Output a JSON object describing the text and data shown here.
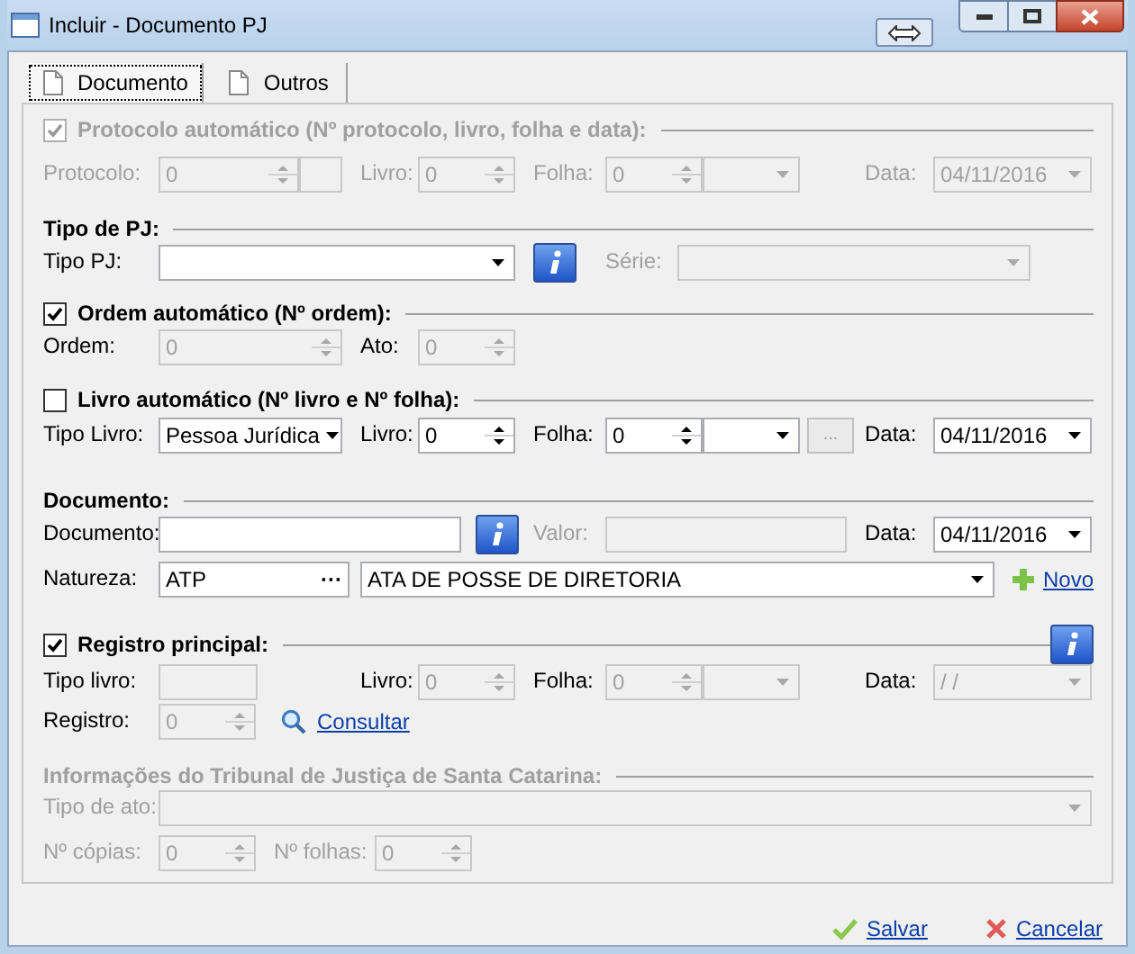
{
  "window": {
    "title": "Incluir - Documento PJ"
  },
  "tabs": [
    {
      "label": "Documento",
      "selected": true
    },
    {
      "label": "Outros",
      "selected": false
    }
  ],
  "protocolo": {
    "title": "Protocolo automático (Nº protocolo, livro, folha e data):",
    "checked": true,
    "disabled": true,
    "protocolo_label": "Protocolo:",
    "protocolo_value": "0",
    "livro_label": "Livro:",
    "livro_value": "0",
    "folha_label": "Folha:",
    "folha_value": "0",
    "data_label": "Data:",
    "data_value": "04/11/2016"
  },
  "tipo_pj": {
    "title": "Tipo de PJ:",
    "tipo_label": "Tipo PJ:",
    "serie_label": "Série:"
  },
  "ordem": {
    "title": "Ordem automático (Nº ordem):",
    "checked": true,
    "ordem_label": "Ordem:",
    "ordem_value": "0",
    "ato_label": "Ato:",
    "ato_value": "0"
  },
  "livro": {
    "title": "Livro automático (Nº livro e Nº folha):",
    "checked": false,
    "tipo_label": "Tipo Livro:",
    "tipo_value": "Pessoa Jurídica",
    "livro_label": "Livro:",
    "livro_value": "0",
    "folha_label": "Folha:",
    "folha_value": "0",
    "more_button": "...",
    "data_label": "Data:",
    "data_value": "04/11/2016"
  },
  "documento": {
    "title": "Documento:",
    "documento_label": "Documento:",
    "valor_label": "Valor:",
    "data_label": "Data:",
    "data_value": "04/11/2016",
    "natureza_label": "Natureza:",
    "natureza_code": "ATP",
    "natureza_button": "···",
    "natureza_value": "ATA DE POSSE DE DIRETORIA",
    "novo_link": "Novo"
  },
  "registro": {
    "title": "Registro principal:",
    "checked": true,
    "fields_disabled": true,
    "tipo_label": "Tipo livro:",
    "livro_label": "Livro:",
    "livro_value": "0",
    "folha_label": "Folha:",
    "folha_value": "0",
    "data_label": "Data:",
    "data_value": " / /",
    "registro_label": "Registro:",
    "registro_value": "0",
    "consultar_link": "Consultar"
  },
  "tribunal": {
    "title": "Informações do Tribunal de Justiça de Santa Catarina:",
    "disabled": true,
    "tipo_ato_label": "Tipo de ato:",
    "copias_label": "Nº cópias:",
    "copias_value": "0",
    "folhas_label": "Nº folhas:",
    "folhas_value": "0"
  },
  "footer": {
    "save": "Salvar",
    "cancel": "Cancelar"
  }
}
